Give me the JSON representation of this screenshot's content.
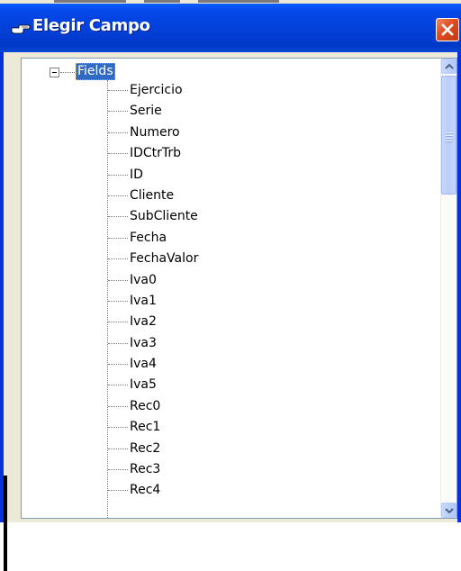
{
  "window": {
    "title": "Elegir Campo",
    "title_icon": "pointing-hand-icon",
    "close_icon": "close-icon"
  },
  "tree": {
    "root": {
      "label": "Fields",
      "expanded": true,
      "selected": true
    },
    "items": [
      {
        "label": "Ejercicio"
      },
      {
        "label": "Serie"
      },
      {
        "label": "Numero"
      },
      {
        "label": "IDCtrTrb"
      },
      {
        "label": "ID"
      },
      {
        "label": "Cliente"
      },
      {
        "label": "SubCliente"
      },
      {
        "label": "Fecha"
      },
      {
        "label": "FechaValor"
      },
      {
        "label": "Iva0"
      },
      {
        "label": "Iva1"
      },
      {
        "label": "Iva2"
      },
      {
        "label": "Iva3"
      },
      {
        "label": "Iva4"
      },
      {
        "label": "Iva5"
      },
      {
        "label": "Rec0"
      },
      {
        "label": "Rec1"
      },
      {
        "label": "Rec2"
      },
      {
        "label": "Rec3"
      },
      {
        "label": "Rec4"
      }
    ]
  },
  "colors": {
    "titlebar": "#0440d8",
    "selection": "#316ac5",
    "close_button": "#e04a20"
  }
}
